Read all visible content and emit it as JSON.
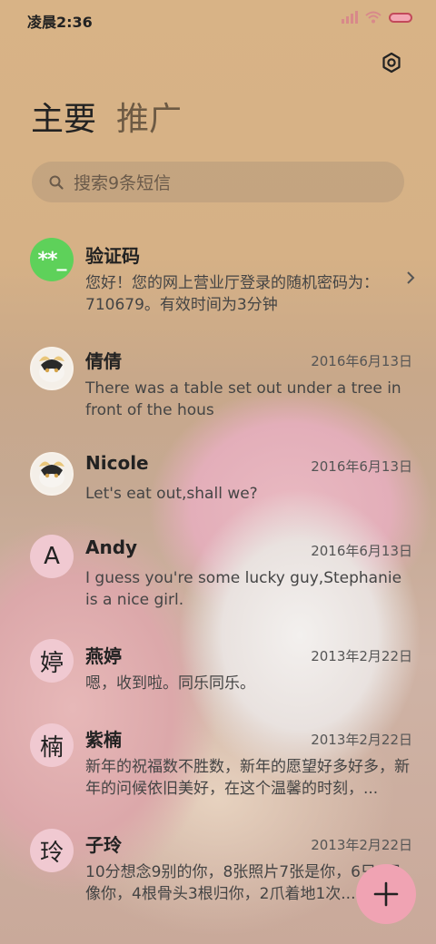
{
  "status": {
    "time": "凌晨2:36"
  },
  "tabs": [
    {
      "label": "主要"
    },
    {
      "label": "推广"
    }
  ],
  "search": {
    "placeholder": "搜索9条短信"
  },
  "conversations": [
    {
      "name": "验证码",
      "avatar": "**_",
      "date": "",
      "preview": "您好！您的网上营业厅登录的随机密码为：710679。有效时间为3分钟"
    },
    {
      "name": "倩倩",
      "avatar": "",
      "date": "2016年6月13日",
      "preview": "There was a table set out under a tree in front of the hous"
    },
    {
      "name": "Nicole",
      "avatar": "",
      "date": "2016年6月13日",
      "preview": "Let's eat out,shall we?"
    },
    {
      "name": "Andy",
      "avatar": "A",
      "date": "2016年6月13日",
      "preview": "I guess you're some lucky guy,Stephanie is a nice girl."
    },
    {
      "name": "燕婷",
      "avatar": "婷",
      "date": "2013年2月22日",
      "preview": "嗯，收到啦。同乐同乐。"
    },
    {
      "name": "紫楠",
      "avatar": "楠",
      "date": "2013年2月22日",
      "preview": "新年的祝福数不胜数，新年的愿望好多好多，新年的问候依旧美好，在这个温馨的时刻，..."
    },
    {
      "name": "子玲",
      "avatar": "玲",
      "date": "2013年2月22日",
      "preview": "10分想念9别的你，8张照片7张是你，6只5只像你，4根骨头3根归你，2爪着地1次..."
    }
  ],
  "icons": {
    "settings": "settings-icon",
    "search": "search-icon",
    "chevron": "chevron-right-icon",
    "compose": "plus-icon"
  },
  "colors": {
    "accent": "#f0a3b3",
    "verify_avatar": "#5ed15a",
    "letter_avatar": "#f0c9d1"
  }
}
